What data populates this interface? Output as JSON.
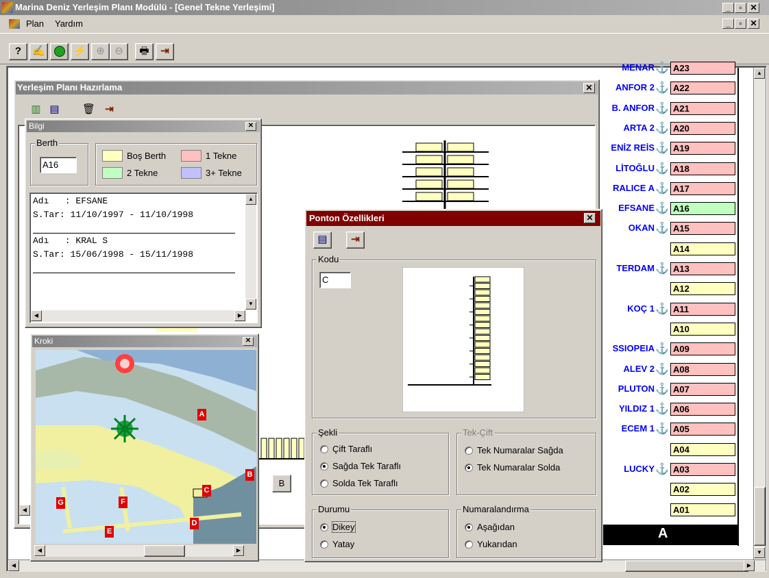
{
  "app": {
    "title": "Marina Deniz Yerleşim Planı Modülü - [Genel Tekne Yerleşimi]",
    "menu": [
      "Plan",
      "Yardım"
    ],
    "window_controls": [
      "_",
      "▫",
      "✕"
    ]
  },
  "berth_list": {
    "section_label": "A",
    "rows": [
      {
        "name": "MENAR",
        "code": "A23",
        "status": "1"
      },
      {
        "name": "ANFOR 2",
        "code": "A22",
        "status": "1"
      },
      {
        "name": "B. ANFOR",
        "code": "A21",
        "status": "1"
      },
      {
        "name": "ARTA 2",
        "code": "A20",
        "status": "1"
      },
      {
        "name": "ENİZ REİS",
        "code": "A19",
        "status": "1"
      },
      {
        "name": "LİTOĞLU",
        "code": "A18",
        "status": "1"
      },
      {
        "name": "RALICE A",
        "code": "A17",
        "status": "1"
      },
      {
        "name": "EFSANE",
        "code": "A16",
        "status": "2"
      },
      {
        "name": "OKAN",
        "code": "A15",
        "status": "1"
      },
      {
        "name": "",
        "code": "A14",
        "status": "0"
      },
      {
        "name": "TERDAM",
        "code": "A13",
        "status": "1"
      },
      {
        "name": "",
        "code": "A12",
        "status": "0"
      },
      {
        "name": "KOÇ 1",
        "code": "A11",
        "status": "1"
      },
      {
        "name": "",
        "code": "A10",
        "status": "0"
      },
      {
        "name": "SSIOPEIA",
        "code": "A09",
        "status": "1"
      },
      {
        "name": "ALEV 2",
        "code": "A08",
        "status": "1"
      },
      {
        "name": "PLUTON",
        "code": "A07",
        "status": "1"
      },
      {
        "name": "YILDIZ 1",
        "code": "A06",
        "status": "1"
      },
      {
        "name": "ECEM 1",
        "code": "A05",
        "status": "1"
      },
      {
        "name": "",
        "code": "A04",
        "status": "0"
      },
      {
        "name": "LUCKY",
        "code": "A03",
        "status": "1"
      },
      {
        "name": "",
        "code": "A02",
        "status": "0"
      },
      {
        "name": "",
        "code": "A01",
        "status": "0"
      }
    ]
  },
  "yerlesim": {
    "title": "Yerleşim Planı Hazırlama",
    "pontoon_button": "B"
  },
  "bilgi": {
    "title": "Bilgi",
    "berth_group": "Berth",
    "berth_value": "A16",
    "legend": [
      {
        "label": "Boş Berth",
        "color": "#ffffc0"
      },
      {
        "label": "1 Tekne",
        "color": "#ffc0c0"
      },
      {
        "label": "2 Tekne",
        "color": "#c0ffc0"
      },
      {
        "label": "3+ Tekne",
        "color": "#c0c0ff"
      }
    ],
    "records": [
      {
        "adi": "Adı   : EFSANE",
        "tar": "S.Tar: 11/10/1997 - 11/10/1998"
      },
      {
        "adi": "Adı   : KRAL S",
        "tar": "S.Tar: 15/06/1998 - 15/11/1998"
      }
    ]
  },
  "kroki": {
    "title": "Kroki",
    "markers": [
      "A",
      "B",
      "C",
      "D",
      "E",
      "F",
      "G"
    ]
  },
  "ponton": {
    "title": "Ponton Özellikleri",
    "kodu_label": "Kodu",
    "kodu_value": "C",
    "sekli": {
      "label": "Şekli",
      "options": [
        "Çift Taraflı",
        "Sağda Tek Taraflı",
        "Solda Tek Taraflı"
      ],
      "selected": 1
    },
    "tekcift": {
      "label": "Tek-Çift",
      "options": [
        "Tek Numaralar Sağda",
        "Tek Numaralar Solda"
      ],
      "selected": 1
    },
    "durumu": {
      "label": "Durumu",
      "options": [
        "Dikey",
        "Yatay"
      ],
      "selected": 0
    },
    "numaralandirma": {
      "label": "Numaralandırma",
      "options": [
        "Aşağıdan",
        "Yukarıdan"
      ],
      "selected": 0
    }
  },
  "colors": {
    "titlebar_active": "#0a246a",
    "titlebar_maroon": "#800000",
    "berth_empty": "#ffffc0",
    "berth_one": "#ffc0c0",
    "berth_two": "#c0ffc0",
    "berth_name": "#0000ff"
  }
}
